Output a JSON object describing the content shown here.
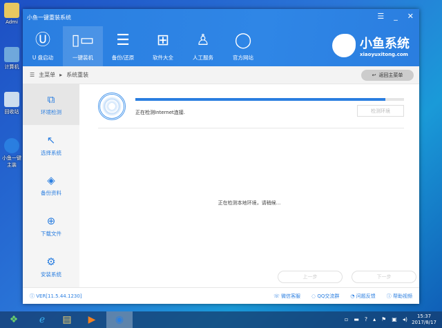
{
  "desktop": {
    "icons": [
      "Admi",
      "计算机",
      "回收站",
      "小鱼一键主装"
    ]
  },
  "window": {
    "title": "小鱼一键重装系统",
    "nav": [
      {
        "label": "U 盘启动",
        "icon": "usb-icon"
      },
      {
        "label": "一键装机",
        "icon": "computer-icon"
      },
      {
        "label": "备份/还原",
        "icon": "backup-icon"
      },
      {
        "label": "软件大全",
        "icon": "apps-grid-icon"
      },
      {
        "label": "人工服务",
        "icon": "person-icon"
      },
      {
        "label": "官方网站",
        "icon": "globe-icon"
      }
    ],
    "logo": {
      "name": "小鱼系统",
      "url": "xiaoyuxitong.com"
    },
    "breadcrumb": {
      "home": "主菜单",
      "current": "系统重装"
    },
    "back_button": "返回主菜单",
    "sidebar": [
      {
        "label": "环境检测",
        "active": true
      },
      {
        "label": "选择系统"
      },
      {
        "label": "备份资料"
      },
      {
        "label": "下载文件"
      },
      {
        "label": "安装系统"
      }
    ],
    "progress": {
      "value": 0.93,
      "status": "正在检测Internet连接.",
      "check_button": "检测环境"
    },
    "center_text": "正在检测本地环境，请稍候...",
    "prev_button": "上一步",
    "next_button": "下一步",
    "footer": {
      "version": "VER[11.5.44.1230]",
      "links": [
        "微信客服",
        "QQ交流群",
        "问题反馈",
        "帮助视频"
      ]
    }
  },
  "taskbar": {
    "time": "15:37",
    "date": "2017/8/17"
  },
  "colors": {
    "accent": "#2a7ee0"
  }
}
